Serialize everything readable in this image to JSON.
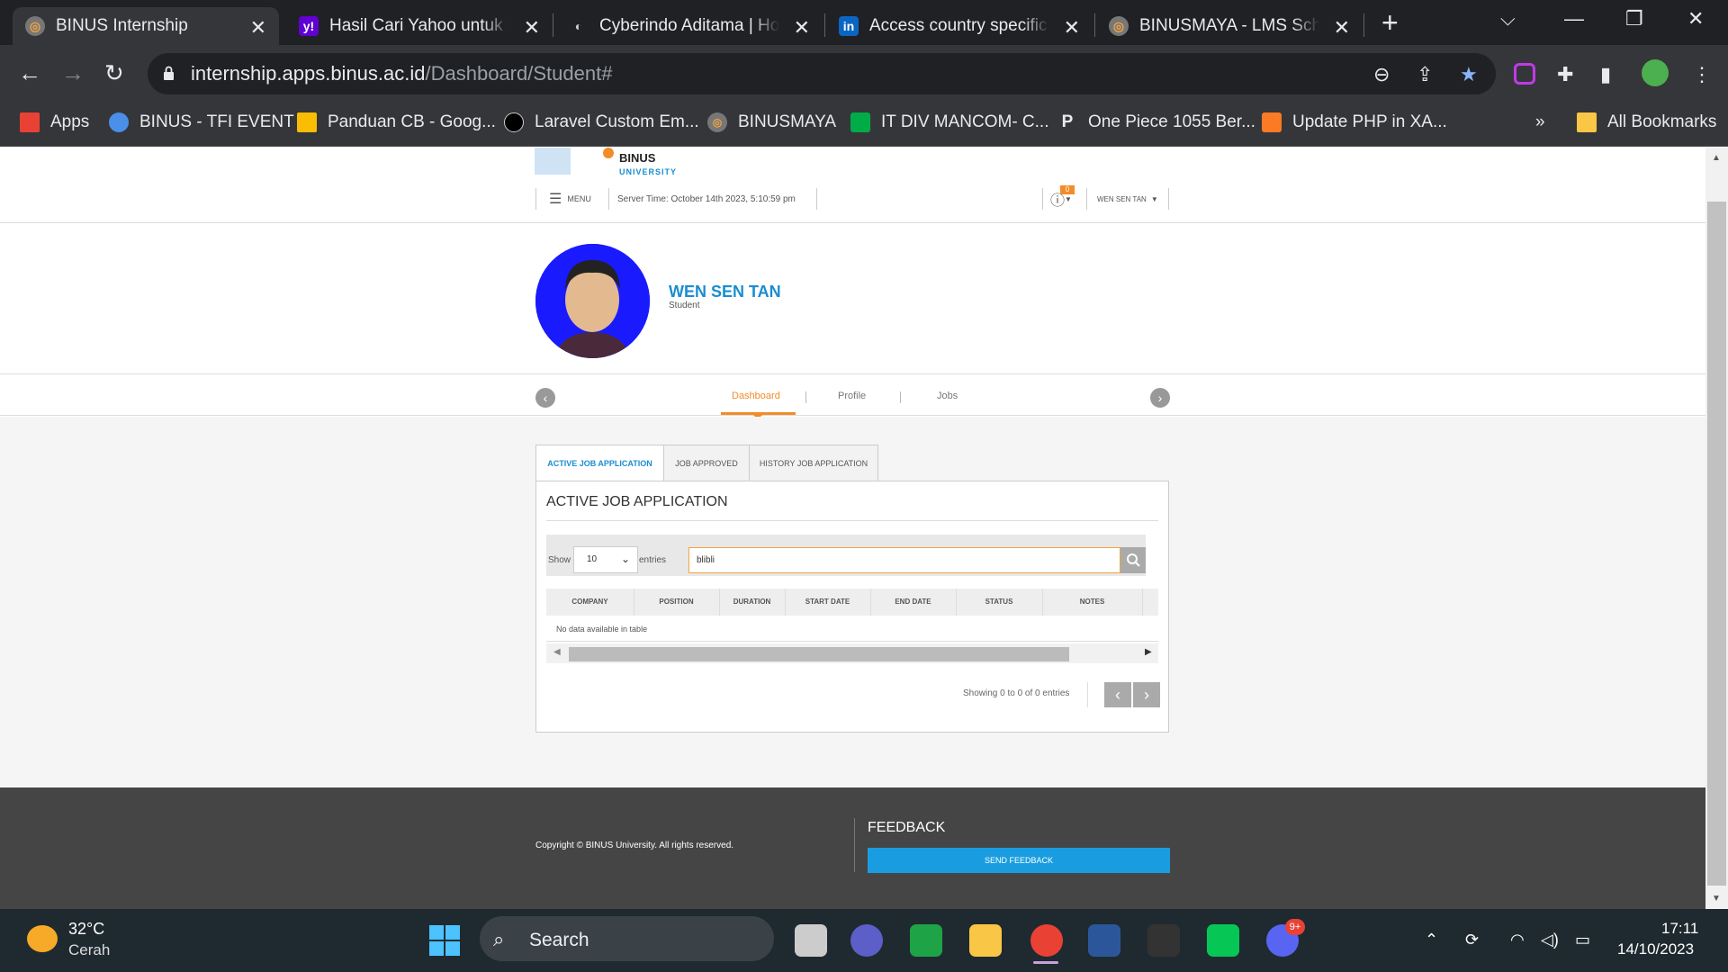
{
  "browser": {
    "tabs": [
      {
        "title": "BINUS Internship",
        "active": true
      },
      {
        "title": "Hasil Cari Yahoo untuk P"
      },
      {
        "title": "Cyberindo Aditama | Hor"
      },
      {
        "title": "Access country specific e"
      },
      {
        "title": "BINUSMAYA - LMS Schec"
      }
    ],
    "url_host": "internship.apps.binus.ac.id",
    "url_path": "/Dashboard/Student#",
    "bookmarks": [
      "Apps",
      "BINUS - TFI EVENT",
      "Panduan CB - Goog...",
      "Laravel Custom Em...",
      "BINUSMAYA",
      "IT DIV MANCOM- C...",
      "One Piece 1055 Ber...",
      "Update PHP in XA..."
    ],
    "bookmarks_more": "»",
    "all_bookmarks": "All Bookmarks"
  },
  "site": {
    "logo_text": "BINUS",
    "logo_sub": "UNIVERSITY",
    "menu_label": "MENU",
    "server_time": "Server Time: October 14th 2023, 5:10:59 pm",
    "notif_count": "0",
    "user_menu": "WEN SEN TAN",
    "profile_name": "WEN SEN TAN",
    "profile_role": "Student",
    "nav": [
      "Dashboard",
      "Profile",
      "Jobs"
    ],
    "subtabs": [
      "ACTIVE JOB APPLICATION",
      "JOB APPROVED",
      "HISTORY JOB APPLICATION"
    ],
    "panel_title": "ACTIVE JOB APPLICATION",
    "show_label": "Show",
    "entries_value": "10",
    "entries_label": "entries",
    "search_value": "blibli",
    "columns": [
      "COMPANY",
      "POSITION",
      "DURATION",
      "START DATE",
      "END DATE",
      "STATUS",
      "NOTES"
    ],
    "no_data": "No data available in table",
    "showing": "Showing 0 to 0 of 0 entries",
    "copyright": "Copyright © BINUS University. All rights reserved.",
    "feedback_title": "FEEDBACK",
    "feedback_button": "SEND FEEDBACK"
  },
  "taskbar": {
    "temperature": "32°C",
    "weather": "Cerah",
    "search_label": "Search",
    "discord_badge": "9+",
    "time": "17:11",
    "date": "14/10/2023"
  },
  "colors": {
    "accent_blue": "#1a8dd1",
    "accent_orange": "#f28c28",
    "footer": "#454545"
  }
}
